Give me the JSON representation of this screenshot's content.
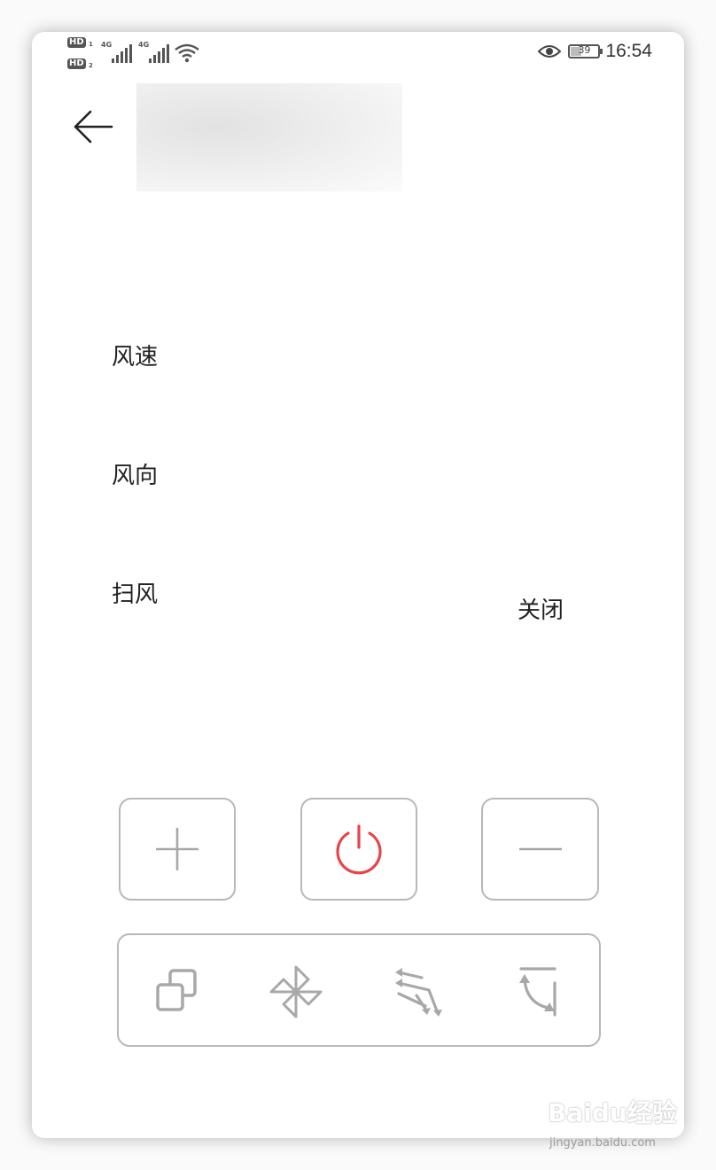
{
  "status_bar": {
    "sim1_badge": "HD",
    "sim1_index": "1",
    "sim2_badge": "HD",
    "sim2_index": "2",
    "network1": "4G",
    "network2": "4G",
    "battery_level": "39",
    "battery_fraction": 0.39,
    "time": "16:54"
  },
  "header": {
    "back_icon": "arrow-left-icon"
  },
  "controls": {
    "wind_speed_label": "风速",
    "wind_direction_label": "风向",
    "sweep_label": "扫风",
    "power_state": "关闭"
  },
  "buttons": {
    "increase_icon": "plus-icon",
    "power_icon": "power-icon",
    "decrease_icon": "minus-icon",
    "mode_icon": "mode-icon",
    "fan_icon": "fan-icon",
    "swing_icon": "swing-icon",
    "timer_icon": "timer-icon"
  },
  "watermark": {
    "logo": "Baidu经验",
    "url": "jingyan.baidu.com"
  },
  "colors": {
    "power_red": "#e8434a",
    "icon_gray": "#a8a8a8",
    "border_gray": "#b8b8b8"
  }
}
